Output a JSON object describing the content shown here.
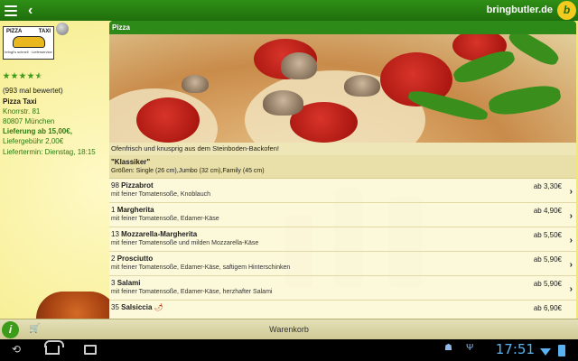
{
  "header": {
    "brand": "bringbutler.de",
    "brand_logo": "b"
  },
  "restaurant": {
    "logo_left": "PIZZA",
    "logo_right": "TAXI",
    "logo_sub": "bringt's schnell · Lieferservice",
    "rating_stars": 4.5,
    "rating_count": "(993 mal bewertet)",
    "name": "Pizza Taxi",
    "street": "Knorrstr. 81",
    "city": "80807 München",
    "min_order": "Lieferung ab 15,00€,",
    "delivery_fee": "Liefergebühr 2,00€",
    "delivery_date": "Liefertermin: Dienstag, 18:15"
  },
  "menu": {
    "category_title": "Pizza",
    "description": "Ofenfrisch und knusprig aus dem Steinboden-Backofen!",
    "section_title": "\"Klassiker\"",
    "section_sizes": "Größen: Single (26 cm),Jumbo (32 cm),Family (45 cm)",
    "items": [
      {
        "number": "98",
        "name": "Pizzabrot",
        "description": "mit feiner Tomatensoße, Knoblauch",
        "price": "ab 3,30€"
      },
      {
        "number": "1",
        "name": "Margherita",
        "description": "mit feiner Tomatensoße, Edamer-Käse",
        "price": "ab 4,90€"
      },
      {
        "number": "13",
        "name": "Mozzarella-Margherita",
        "description": "mit feiner Tomatensoße und milden Mozzarella-Käse",
        "price": "ab 5,50€"
      },
      {
        "number": "2",
        "name": "Prosciutto",
        "description": "mit feiner Tomatensoße, Edamer-Käse, saftigem Hinterschinken",
        "price": "ab 5,90€"
      },
      {
        "number": "3",
        "name": "Salami",
        "description": "mit feiner Tomatensoße, Edamer-Käse, herzhafter Salami",
        "price": "ab 5,90€"
      },
      {
        "number": "35",
        "name": "Salsiccia",
        "description": "",
        "price": "ab 6,90€"
      }
    ]
  },
  "bottom": {
    "info_label": "i",
    "cart_label": "Warenkorb"
  },
  "system": {
    "clock": "17:51"
  },
  "colors": {
    "brand_green": "#2e8a18",
    "sidebar_green_text": "#2c7a10",
    "background_yellow": "#f6ef9a",
    "clock_blue": "#5ab3f0"
  }
}
